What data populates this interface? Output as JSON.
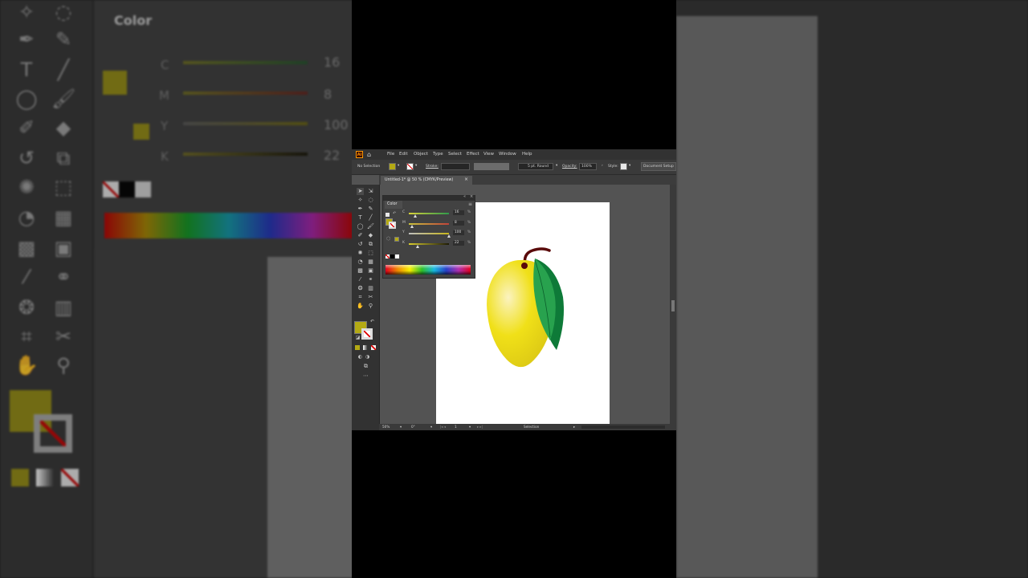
{
  "background_zoom": {
    "panel_title": "Color",
    "rows": [
      {
        "label": "C",
        "value": "16"
      },
      {
        "label": "M",
        "value": "8"
      },
      {
        "label": "Y",
        "value": "100"
      },
      {
        "label": "K",
        "value": "22"
      }
    ]
  },
  "app": {
    "logo": "Ai",
    "menu": [
      "File",
      "Edit",
      "Object",
      "Type",
      "Select",
      "Effect",
      "View",
      "Window",
      "Help"
    ],
    "control_bar": {
      "selection_status": "No Selection",
      "stroke_label": "Stroke:",
      "brush_label": "5 pt. Round",
      "opacity_label": "Opacity:",
      "opacity_value": "100%",
      "style_label": "Style:",
      "document_setup": "Document Setup"
    },
    "document_tab": {
      "title": "Untitled-1* @ 50 % (CMYK/Preview)",
      "close": "×"
    },
    "color_panel": {
      "tab_label": "Color",
      "rows": [
        {
          "label": "C",
          "value": "16",
          "level": 0.16,
          "track": "linear-gradient(90deg,#d8d23a,#2f9a4a)"
        },
        {
          "label": "M",
          "value": "8",
          "level": 0.08,
          "track": "linear-gradient(90deg,#c9c23c,#c0433a)"
        },
        {
          "label": "Y",
          "value": "100",
          "level": 1.0,
          "track": "linear-gradient(90deg,#c0c0c0,#c7b51a)"
        },
        {
          "label": "K",
          "value": "22",
          "level": 0.22,
          "track": "linear-gradient(90deg,#d8cc30,#1d1a05)"
        }
      ],
      "percent": "%"
    },
    "status_bar": {
      "zoom": "50%",
      "rotation": "0°",
      "artboard": "1",
      "tool": "Selection"
    },
    "fill_color": "#b4aa14",
    "stroke_color": "none"
  },
  "colors": {
    "mango_highlight": "#fbf3c0",
    "mango_yellow": "#f0e018",
    "mango_shadow": "#d8c414",
    "leaf_light": "#28a24e",
    "leaf_dark": "#0e7a38",
    "stem": "#5a0a0a"
  }
}
